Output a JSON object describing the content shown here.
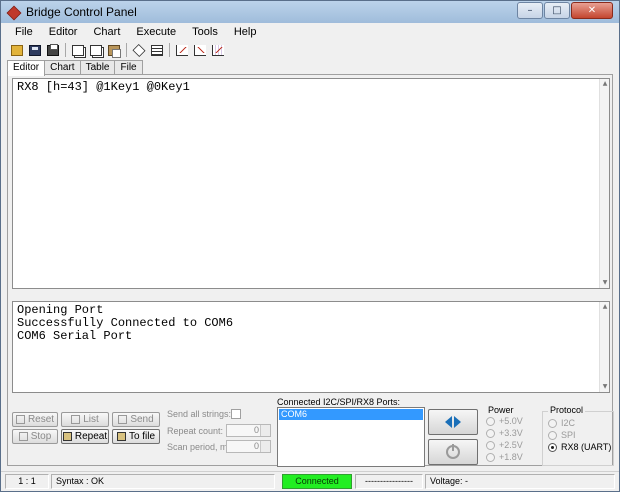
{
  "window": {
    "title": "Bridge Control Panel",
    "controls": [
      "–",
      "□",
      "✕"
    ]
  },
  "menu": [
    "File",
    "Editor",
    "Chart",
    "Execute",
    "Tools",
    "Help"
  ],
  "toolbar": [
    "open-icon",
    "save-icon",
    "print-icon",
    "copy-icon",
    "paste-icon",
    "erase-icon",
    "list-icon",
    "chart-icon",
    "chart-icon",
    "chart-icon"
  ],
  "tabs": [
    "Editor",
    "Chart",
    "Table",
    "File"
  ],
  "editor": {
    "lines": [
      "RX8 [h=43] @1Key1 @0Key1"
    ]
  },
  "console": {
    "lines": [
      "Opening Port",
      "Successfully Connected to COM6",
      "COM6 Serial Port"
    ]
  },
  "buttons": {
    "reset": "Reset",
    "list": "List",
    "send": "Send",
    "stop": "Stop",
    "repeat": "Repeat",
    "to_file": "To file"
  },
  "options": {
    "send_all": "Send all strings:",
    "repeat_count": "Repeat count:",
    "repeat_count_value": "0",
    "scan_period": "Scan period, ms:",
    "scan_period_value": "0"
  },
  "ports": {
    "title": "Connected I2C/SPI/RX8 Ports:",
    "items": [
      "COM6"
    ]
  },
  "power": {
    "title": "Power",
    "options": [
      "+5.0V",
      "+3.3V",
      "+2.5V",
      "+1.8V"
    ]
  },
  "protocol": {
    "title": "Protocol",
    "options": [
      "I2C",
      "SPI",
      "RX8 (UART)"
    ],
    "selected": "RX8 (UART)"
  },
  "status": {
    "position": "1 : 1",
    "syntax": "Syntax : OK",
    "connection": "Connected",
    "dashes": "----------------",
    "voltage": "Voltage: -"
  },
  "colors": {
    "connected": "#22ee22",
    "port_selected": "#3399ff",
    "arrow": "#1a6fb8"
  }
}
